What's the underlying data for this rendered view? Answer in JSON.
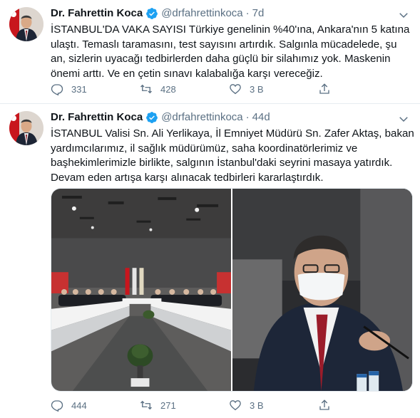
{
  "colors": {
    "verified": "#1da1f2",
    "muted": "#5b7083",
    "text": "#0f1419",
    "divider": "#e6ecf0"
  },
  "tweets": [
    {
      "author": "Dr. Fahrettin Koca",
      "handle": "@drfahrettinkoca",
      "separator": "·",
      "time": "7d",
      "text": "İSTANBUL'DA VAKA SAYISI Türkiye genelinin %40'ına, Ankara'nın 5 katına ulaştı. Temaslı taramasını, test sayısını artırdık. Salgınla mücadelede, şu an, sizlerin uyacağı tedbirlerden daha güçlü bir silahımız yok. Maskenin önemi arttı. Ve en çetin sınavı kalabalığa karşı vereceğiz.",
      "replies": "331",
      "retweets": "428",
      "likes": "3 B",
      "icons": [
        "reply-icon",
        "retweet-icon",
        "like-icon",
        "share-icon"
      ]
    },
    {
      "author": "Dr. Fahrettin Koca",
      "handle": "@drfahrettinkoca",
      "separator": "·",
      "time": "44d",
      "text": "İSTANBUL Valisi Sn. Ali Yerlikaya, İl Emniyet Müdürü Sn. Zafer Aktaş, bakan yardımcılarımız, il sağlık müdürümüz, saha koordinatörlerimiz ve başhekimlerimizle birlikte, salgının İstanbul'daki seyrini masaya yatırdık. Devam eden artışa karşı alınacak tedbirleri kararlaştırdık.",
      "replies": "444",
      "retweets": "271",
      "likes": "3 B",
      "media": [
        "meeting-room-photo",
        "masked-minister-photo"
      ]
    }
  ]
}
